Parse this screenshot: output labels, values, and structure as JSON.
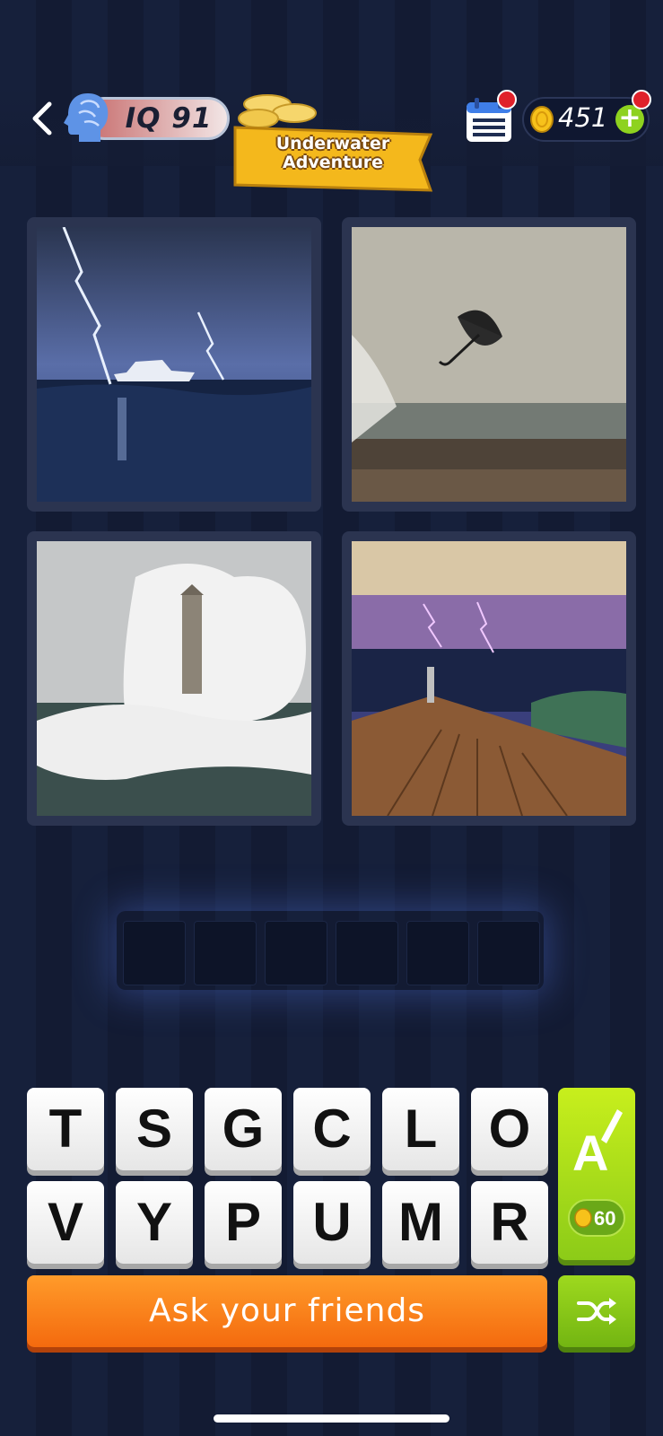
{
  "header": {
    "back_icon": "chevron-left-icon",
    "iq_label": "IQ 91",
    "level_banner": [
      "Underwater",
      "Adventure"
    ],
    "calendar_icon": "calendar-icon",
    "coins": "451",
    "add_coins_icon": "plus-icon"
  },
  "puzzle": {
    "images": [
      {
        "name": "boat-lightning-image"
      },
      {
        "name": "umbrella-waves-image"
      },
      {
        "name": "lighthouse-waves-image"
      },
      {
        "name": "deck-storm-image"
      }
    ],
    "answer_length": 6
  },
  "keyboard": {
    "row1": [
      "T",
      "S",
      "G",
      "C",
      "L",
      "O"
    ],
    "row2": [
      "V",
      "Y",
      "P",
      "U",
      "M",
      "R"
    ]
  },
  "hint": {
    "price": "60",
    "icon": "paint-letter-icon"
  },
  "ask_friends_label": "Ask your friends",
  "shuffle_icon": "shuffle-icon",
  "colors": {
    "accent_orange": "#f46a0e",
    "accent_green": "#8ccb18",
    "background": "#141d36"
  }
}
